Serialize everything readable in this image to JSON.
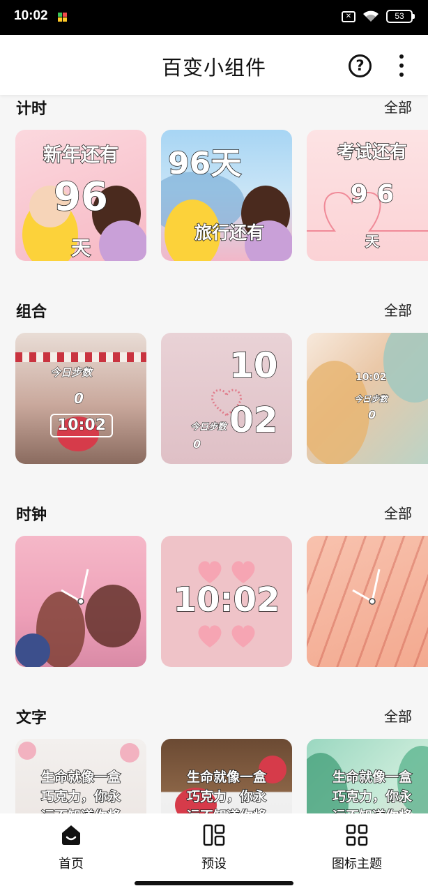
{
  "status": {
    "time": "10:02",
    "signal_box": "✕",
    "battery": "53"
  },
  "header": {
    "title": "百变小组件",
    "help": "?"
  },
  "sections": [
    {
      "title": "计时",
      "all_label": "全部",
      "cards": [
        {
          "line1": "新年还有",
          "number": "96",
          "unit": "天"
        },
        {
          "number": "96天",
          "caption": "旅行还有"
        },
        {
          "line1": "考试还有",
          "number": "9 6",
          "unit": "天"
        }
      ]
    },
    {
      "title": "组合",
      "all_label": "全部",
      "cards": [
        {
          "steps_label": "今日步数",
          "steps": "0",
          "time": "10:02"
        },
        {
          "hour": "10",
          "minute": "02",
          "steps_label": "今日步数",
          "steps": "0"
        },
        {
          "time": "10:02",
          "steps_label": "今日步数",
          "steps": "0"
        }
      ]
    },
    {
      "title": "时钟",
      "all_label": "全部",
      "cards": [
        {
          "kind": "analog"
        },
        {
          "time": "10:02"
        },
        {
          "kind": "analog"
        }
      ]
    },
    {
      "title": "文字",
      "all_label": "全部",
      "cards": [
        {
          "text_line1": "生命就像一盒",
          "text_line2": "巧克力，你永",
          "text_line3": "远不知道你将"
        },
        {
          "text_line1": "生命就像一盒",
          "text_line2": "巧克力，你永",
          "text_line3": "远不知道你将"
        },
        {
          "text_line1": "生命就像一盒",
          "text_line2": "巧克力，你永",
          "text_line3": "远不知道你将"
        }
      ]
    }
  ],
  "nav": {
    "items": [
      {
        "label": "首页",
        "icon": "home-icon",
        "active": true
      },
      {
        "label": "预设",
        "icon": "preset-icon",
        "active": false
      },
      {
        "label": "图标主题",
        "icon": "grid-icon",
        "active": false
      }
    ]
  },
  "colors": {
    "text": "#111111",
    "background": "#f6f6f6"
  }
}
